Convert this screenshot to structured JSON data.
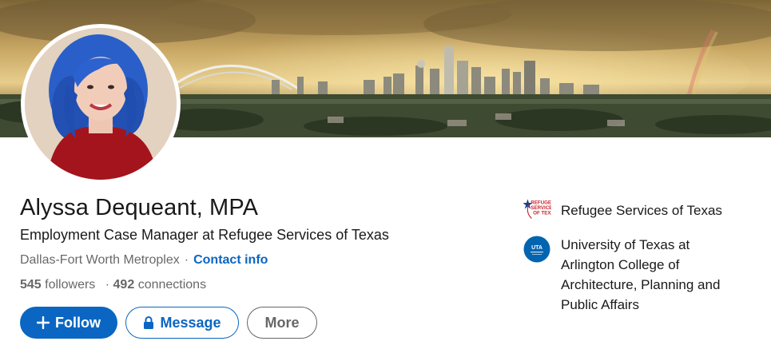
{
  "profile": {
    "name": "Alyssa Dequeant, MPA",
    "headline": "Employment Case Manager at Refugee Services of Texas",
    "location": "Dallas-Fort Worth Metroplex",
    "separator": "·",
    "contact_info": "Contact info",
    "followers_count": "545",
    "followers_label": "followers",
    "connections_prefix": "·",
    "connections_count": "492",
    "connections_label": "connections"
  },
  "actions": {
    "follow": "Follow",
    "message": "Message",
    "more": "More"
  },
  "organizations": [
    {
      "name": "Refugee Services of Texas",
      "logo_icon": "refugee-services-of-texas-logo",
      "logo_text": "REFUGEE SERVICES OF TEXAS"
    },
    {
      "name": "University of Texas at Arlington College of Architecture, Planning and Public Affairs",
      "logo_icon": "uta-logo",
      "logo_text": "UTA"
    }
  ],
  "colors": {
    "brand_blue": "#0a66c2",
    "uta_blue": "#0064b1",
    "rst_red": "#c8262f"
  },
  "icons": {
    "follow": "plus-icon",
    "message": "lock-icon"
  }
}
